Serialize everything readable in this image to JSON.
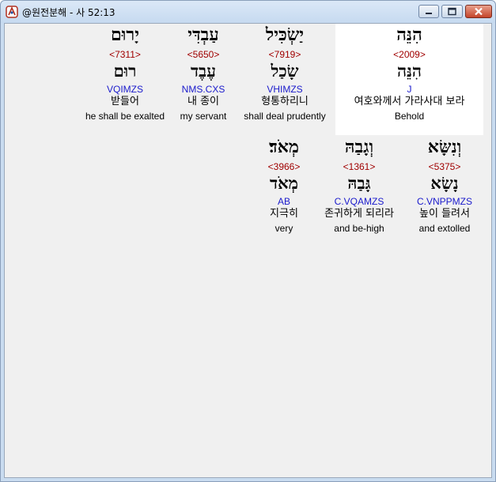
{
  "window": {
    "title": "@원전분해 - 사 52:13"
  },
  "words": [
    {
      "hebrew": "הִנֵּה",
      "strong": "<2009>",
      "lemma": "הִנֵּה",
      "morph": "J",
      "korean": "여호와께서 가라사대 보라",
      "english": "Behold"
    },
    {
      "hebrew": "יַשְׂכִּיל",
      "strong": "<7919>",
      "lemma": "שָׂכַל",
      "morph": "VHIMZS",
      "korean": "형통하리니",
      "english": "shall deal prudently"
    },
    {
      "hebrew": "עַבְדִּי",
      "strong": "<5650>",
      "lemma": "עֶבֶד",
      "morph": "NMS.CXS",
      "korean": "내 종이",
      "english": "my servant"
    },
    {
      "hebrew": "יָרוּם",
      "strong": "<7311>",
      "lemma": "רוּם",
      "morph": "VQIMZS",
      "korean": "받들어",
      "english": "he shall be exalted"
    },
    {
      "hebrew": "וְנִשָּׂא",
      "strong": "<5375>",
      "lemma": "נָשָׂא",
      "morph": "C.VNPPMZS",
      "korean": "높이 들려서",
      "english": "and extolled"
    },
    {
      "hebrew": "וְגָבַהּ",
      "strong": "<1361>",
      "lemma": "גָּבַהּ",
      "morph": "C.VQAMZS",
      "korean": "존귀하게 되리라",
      "english": "and be-high"
    },
    {
      "hebrew": "מְאֹד׃",
      "strong": "<3966>",
      "lemma": "מְאֹד",
      "morph": "AB",
      "korean": "지극히",
      "english": "very"
    }
  ],
  "colors": {
    "strong": "#a00000",
    "morph": "#1a1acc",
    "highlight": "#ffffff"
  },
  "icons": [
    "app-icon",
    "minimize-icon",
    "maximize-icon",
    "close-icon"
  ]
}
